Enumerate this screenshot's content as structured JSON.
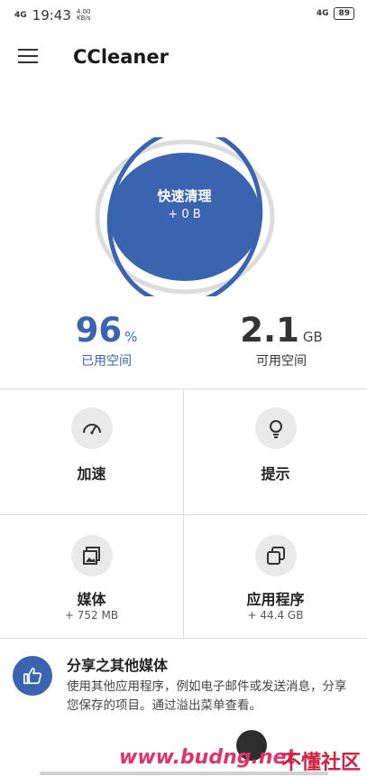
{
  "status_bar": {
    "signal_left": "4G",
    "time": "19:43",
    "speed_value": "4.00",
    "speed_unit": "KB/s",
    "signal_right": "4G",
    "battery": "89"
  },
  "app_bar": {
    "title": "CCleaner"
  },
  "clean": {
    "label": "快速清理",
    "size": "+ 0 B",
    "ring_fill_fraction": 0.93,
    "colors": {
      "primary": "#3a64b0",
      "ring_track": "#dcdcdc"
    }
  },
  "storage": {
    "used_value": "96",
    "used_unit": "%",
    "used_label": "已用空间",
    "free_value": "2.1",
    "free_unit": "GB",
    "free_label": "可用空间"
  },
  "tiles": [
    {
      "label": "加速",
      "sub": "",
      "icon": "speedometer-icon"
    },
    {
      "label": "提示",
      "sub": "",
      "icon": "lightbulb-icon"
    },
    {
      "label": "媒体",
      "sub": "+ 752 MB",
      "icon": "image-icon"
    },
    {
      "label": "应用程序",
      "sub": "+ 44.4 GB",
      "icon": "apps-stack-icon"
    }
  ],
  "share": {
    "title": "分享之其他媒体",
    "body": "使用其他应用程序，例如电子邮件或发送消息，分享您保存的项目。通过溢出菜单查看。",
    "icon": "thumbs-up-icon"
  },
  "watermark": {
    "site": "www.budng.net",
    "brand": "不懂社区"
  }
}
